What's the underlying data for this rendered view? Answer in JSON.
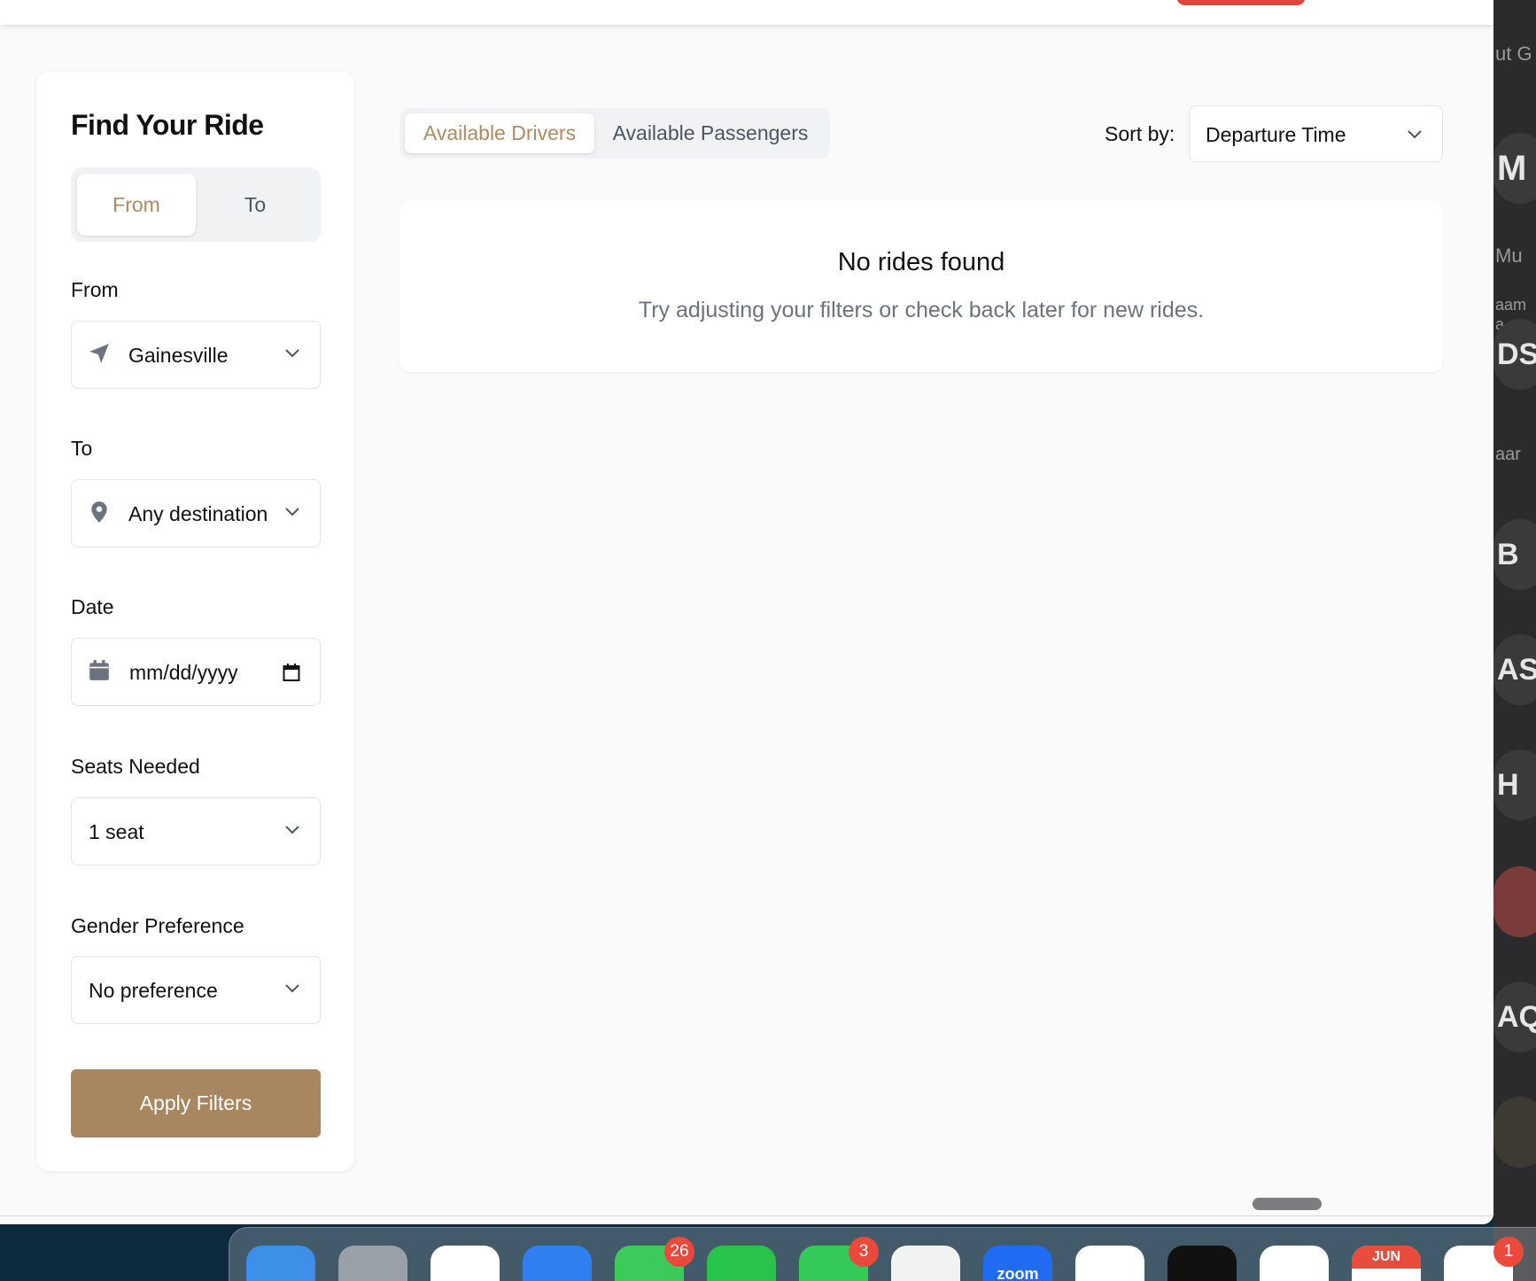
{
  "filters": {
    "title": "Find Your Ride",
    "mode_toggle": {
      "from_label": "From",
      "to_label": "To",
      "active": "From"
    },
    "from_label": "From",
    "from_value": "Gainesville",
    "to_label": "To",
    "to_value": "Any destination",
    "date_label": "Date",
    "date_placeholder": "mm/dd/yyyy",
    "seats_label": "Seats Needed",
    "seats_value": "1 seat",
    "gender_label": "Gender Preference",
    "gender_value": "No preference",
    "apply_label": "Apply Filters"
  },
  "results": {
    "tabs": [
      {
        "label": "Available Drivers",
        "active": true
      },
      {
        "label": "Available Passengers",
        "active": false
      }
    ],
    "sort_label": "Sort by:",
    "sort_value": "Departure Time",
    "empty_title": "No rides found",
    "empty_subtitle": "Try adjusting your filters or check back later for new rides."
  },
  "side_app": {
    "fragments": [
      "ut G",
      "M",
      "Mu",
      "aam",
      "a qu",
      "DS",
      "aar",
      "B",
      "AS",
      "H",
      "AQ"
    ]
  },
  "dock": {
    "items": [
      {
        "name": "finder-icon",
        "color": "#3d8fe8"
      },
      {
        "name": "launchpad-icon",
        "color": "#9aa0a8"
      },
      {
        "name": "chrome-icon",
        "color": "#ffffff"
      },
      {
        "name": "mail-icon",
        "color": "#2f7ff0"
      },
      {
        "name": "messages-icon",
        "color": "#3ccb5a",
        "badge": "26"
      },
      {
        "name": "whatsapp-icon",
        "color": "#27c449"
      },
      {
        "name": "facetime-icon",
        "color": "#35c95a",
        "badge": "3"
      },
      {
        "name": "find-my-icon",
        "color": "#f2f2f2"
      },
      {
        "name": "zoom-icon",
        "color": "#1f6bf2",
        "label": "zoom"
      },
      {
        "name": "vscode-icon",
        "color": "#ffffff"
      },
      {
        "name": "mailspring-icon",
        "color": "#111111"
      },
      {
        "name": "chatgpt-icon",
        "color": "#ffffff"
      },
      {
        "name": "calendar-icon",
        "color": "#ffffff",
        "label": "JUN"
      },
      {
        "name": "reminders-icon",
        "color": "#ffffff",
        "badge": "1"
      }
    ]
  },
  "colors": {
    "accent": "#b08a60",
    "button": "#a8865f"
  }
}
